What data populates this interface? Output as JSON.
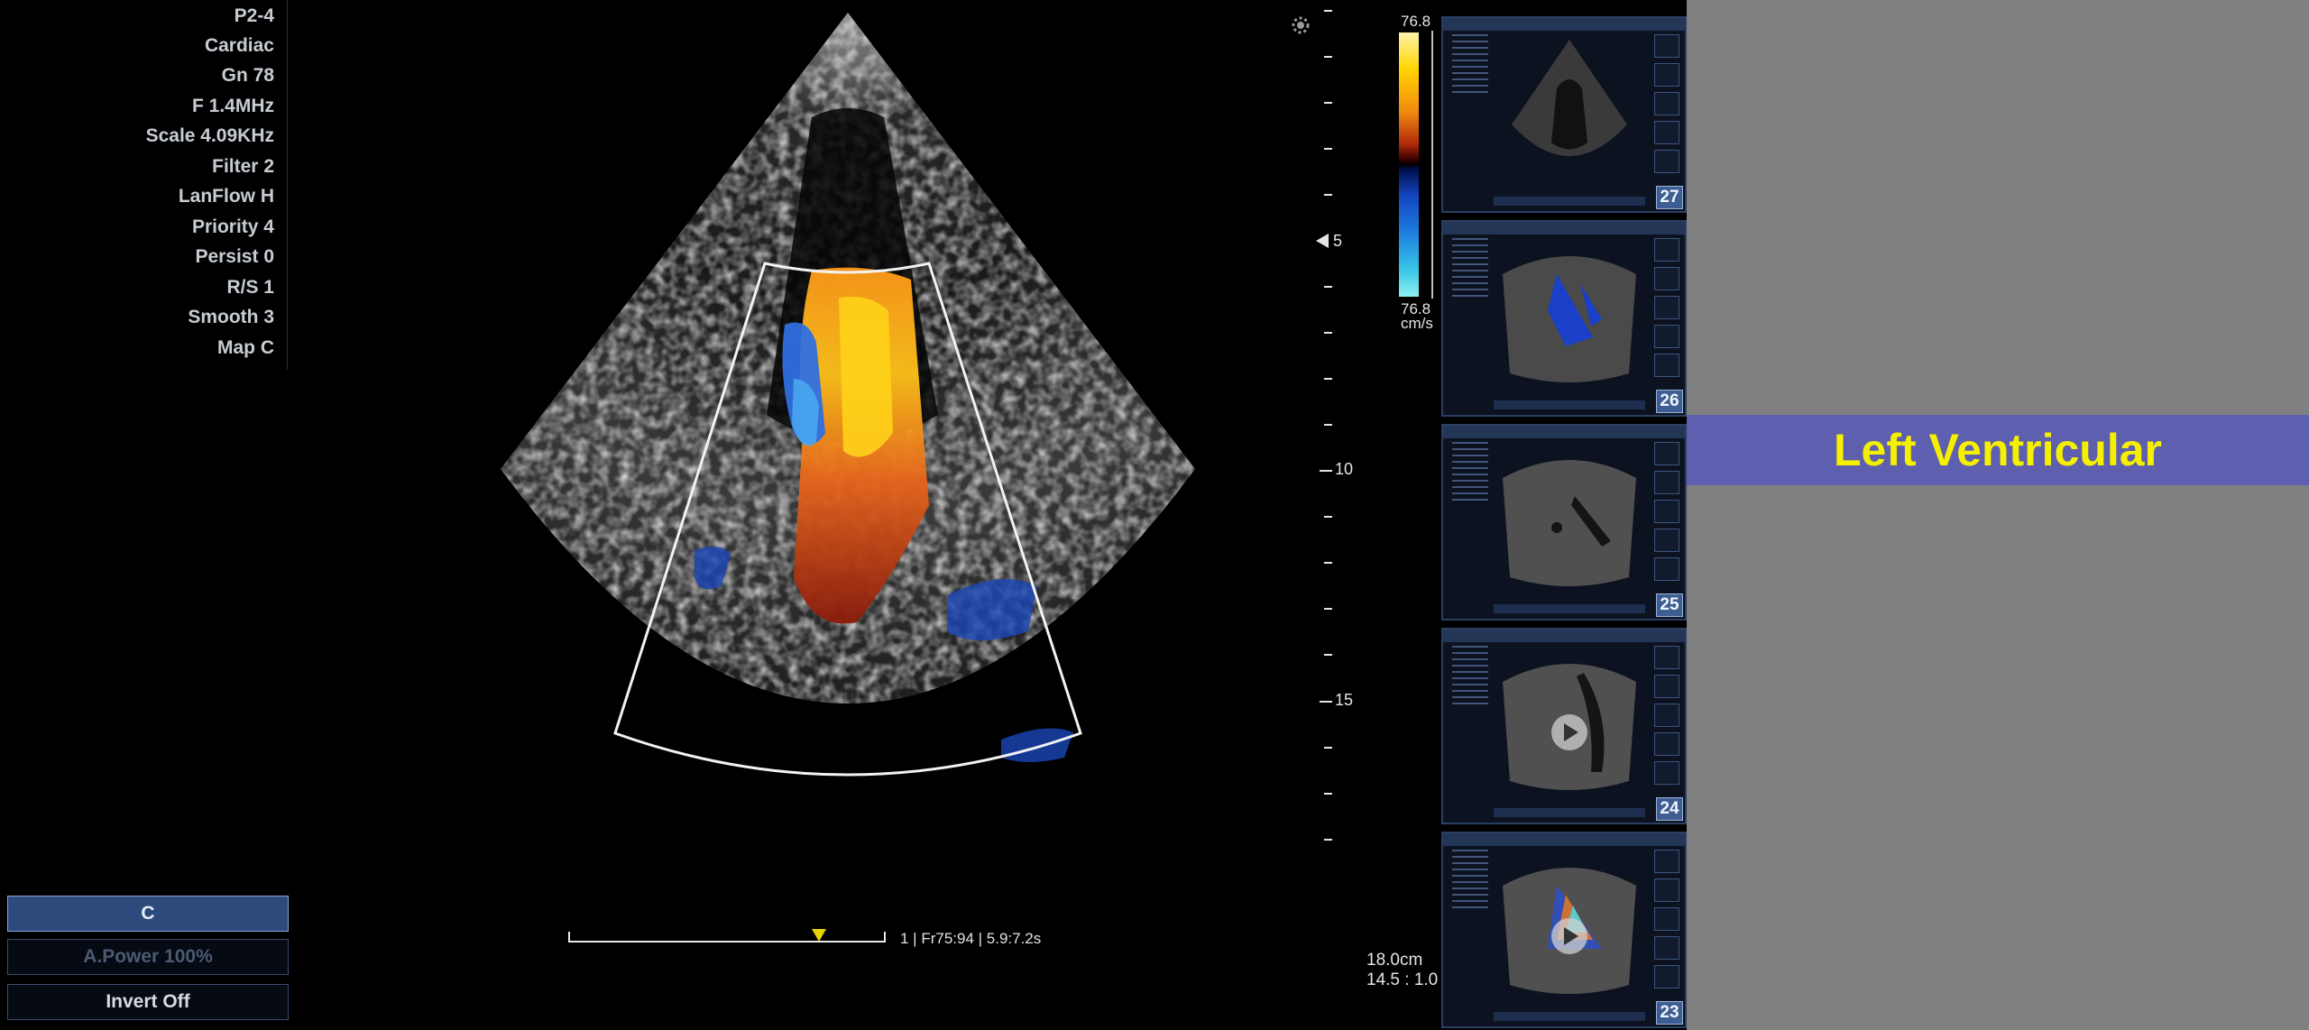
{
  "params": [
    "P2-4",
    "Cardiac",
    "Gn 78",
    "F 1.4MHz",
    "Scale 4.09KHz",
    "Filter 2",
    "LanFlow H",
    "Priority 4",
    "Persist 0",
    "R/S 1",
    "Smooth 3",
    "Map C"
  ],
  "controls": {
    "mode_label": "C",
    "apower_label": "A.Power 100%",
    "invert_label": "Invert  Off"
  },
  "depth_ruler": {
    "labels": [
      "5",
      "10",
      "15"
    ]
  },
  "status": {
    "text": "1 | Fr75:94 | 5.9:7.2s"
  },
  "color_scale": {
    "top_value": "76.8",
    "bottom_value": "76.8",
    "unit": "cm/s"
  },
  "depth_info": {
    "depth": "18.0cm",
    "ratio": "14.5 : 1.0"
  },
  "thumbnails": [
    {
      "number": "27"
    },
    {
      "number": "26"
    },
    {
      "number": "25"
    },
    {
      "number": "24"
    },
    {
      "number": "23"
    }
  ],
  "title_band": {
    "text": "Left Ventricular"
  }
}
